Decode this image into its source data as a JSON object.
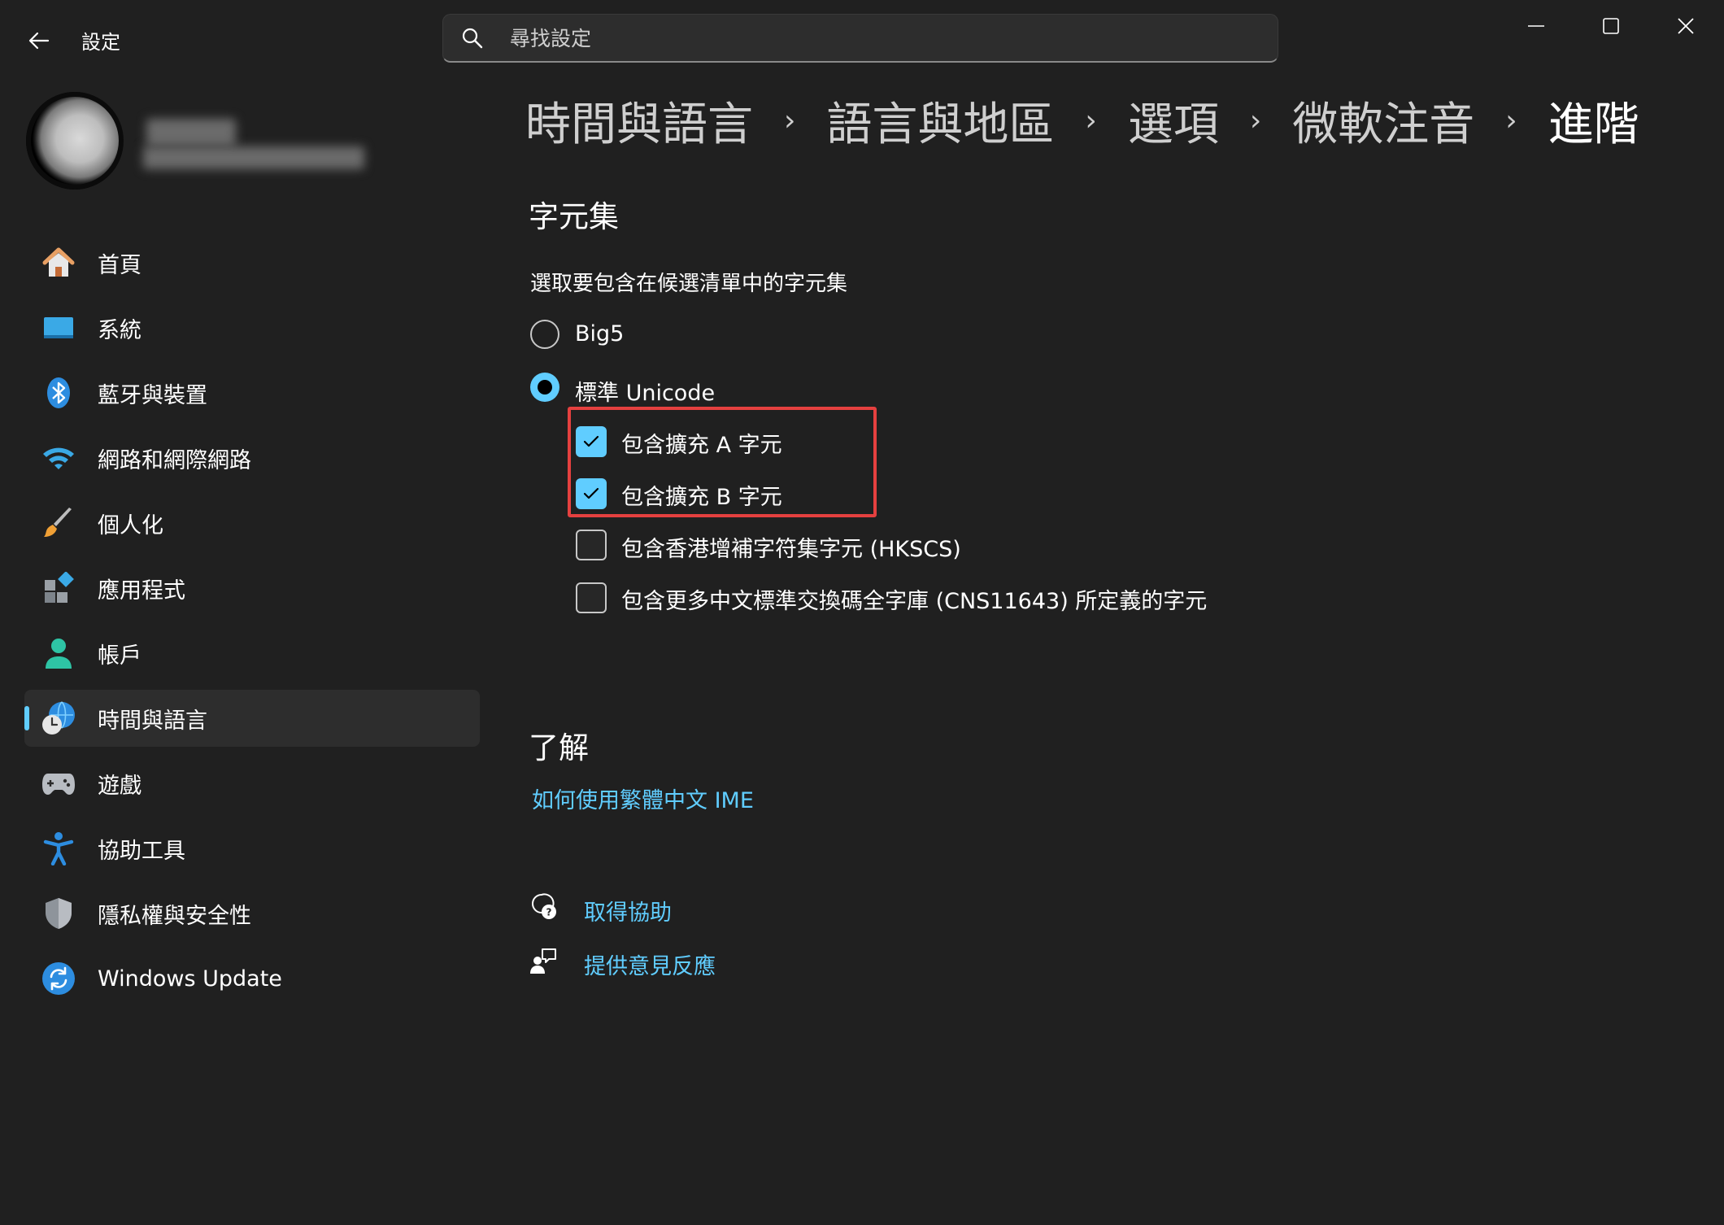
{
  "window": {
    "title": "設定",
    "controls": {
      "minimize": "minimize",
      "maximize": "maximize",
      "close": "close"
    }
  },
  "search": {
    "placeholder": "尋找設定",
    "value": ""
  },
  "sidebar": {
    "items": [
      {
        "label": "首頁",
        "icon": "home-icon"
      },
      {
        "label": "系統",
        "icon": "system-icon"
      },
      {
        "label": "藍牙與裝置",
        "icon": "bluetooth-icon"
      },
      {
        "label": "網路和網際網路",
        "icon": "wifi-icon"
      },
      {
        "label": "個人化",
        "icon": "brush-icon"
      },
      {
        "label": "應用程式",
        "icon": "apps-icon"
      },
      {
        "label": "帳戶",
        "icon": "account-icon"
      },
      {
        "label": "時間與語言",
        "icon": "time-language-icon",
        "selected": true
      },
      {
        "label": "遊戲",
        "icon": "gamepad-icon"
      },
      {
        "label": "協助工具",
        "icon": "accessibility-icon"
      },
      {
        "label": "隱私權與安全性",
        "icon": "shield-icon"
      },
      {
        "label": "Windows Update",
        "icon": "windows-update-icon"
      }
    ]
  },
  "breadcrumb": {
    "items": [
      "時間與語言",
      "語言與地區",
      "選項",
      "微軟注音",
      "進階"
    ],
    "separator": "›"
  },
  "charset": {
    "heading": "字元集",
    "description": "選取要包含在候選清單中的字元集",
    "radios": [
      {
        "label": "Big5",
        "checked": false
      },
      {
        "label": "標準 Unicode",
        "checked": true
      }
    ],
    "checkboxes": [
      {
        "label": "包含擴充 A 字元",
        "checked": true
      },
      {
        "label": "包含擴充 B 字元",
        "checked": true
      },
      {
        "label": "包含香港增補字符集字元 (HKSCS)",
        "checked": false
      },
      {
        "label": "包含更多中文標準交換碼全字庫 (CNS11643) 所定義的字元",
        "checked": false
      }
    ]
  },
  "learn": {
    "heading": "了解",
    "link": "如何使用繁體中文 IME"
  },
  "footer": {
    "get_help": "取得協助",
    "feedback": "提供意見反應"
  },
  "colors": {
    "background": "#202020",
    "accent": "#60cdff",
    "selected_nav": "#2d2d2d",
    "highlight_box": "#e5403f"
  }
}
